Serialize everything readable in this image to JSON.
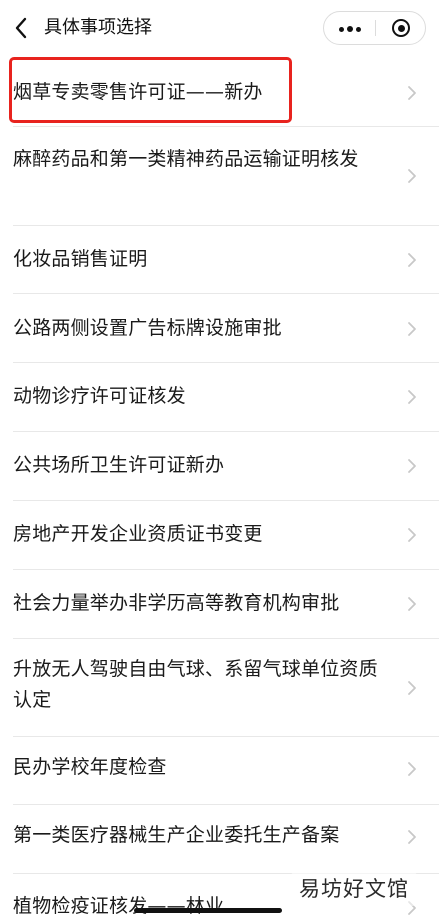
{
  "header": {
    "title": "具体事项选择"
  },
  "icons": {
    "back": "chevron-left-icon",
    "more": "more-dots-icon",
    "close": "target-close-icon",
    "item_arrow": "chevron-right-icon"
  },
  "colors": {
    "highlight_border": "#e8231e",
    "separator": "#e8e8e8",
    "chevron": "#c8c8c8",
    "text": "#1a1a1a"
  },
  "items": [
    {
      "label": "烟草专卖零售许可证——新办",
      "highlighted": true
    },
    {
      "label": "麻醉药品和第一类精神药品运输证明核发"
    },
    {
      "label": "化妆品销售证明"
    },
    {
      "label": "公路两侧设置广告标牌设施审批"
    },
    {
      "label": "动物诊疗许可证核发"
    },
    {
      "label": "公共场所卫生许可证新办"
    },
    {
      "label": "房地产开发企业资质证书变更"
    },
    {
      "label": "社会力量举办非学历高等教育机构审批"
    },
    {
      "label": "升放无人驾驶自由气球、系留气球单位资质认定"
    },
    {
      "label": "民办学校年度检查"
    },
    {
      "label": "第一类医疗器械生产企业委托生产备案"
    },
    {
      "label": "植物检疫证核发——林业"
    }
  ],
  "watermark": {
    "text": "易坊好文馆"
  }
}
